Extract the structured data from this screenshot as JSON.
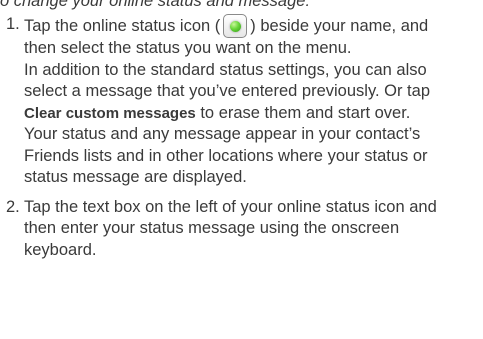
{
  "intro": "o change your online status and message:",
  "steps": [
    {
      "number": "1.",
      "main_before": "Tap the online status icon (",
      "main_after": ") beside your name, and then select the status you want on the menu.",
      "para2_before": "In addition to the standard status settings, you can also select a message that you’ve entered previously. Or tap ",
      "para2_bold": "Clear custom messages",
      "para2_after": " to erase them and start over.",
      "para3": "Your status and any message appear in your contact’s Friends lists and in other locations where your status or status message are displayed."
    },
    {
      "number": "2.",
      "main": "Tap the text box on the left of your online status icon and then enter your status message using the onscreen keyboard."
    }
  ],
  "icons": {
    "status_icon": "online-status-green-dot-icon"
  },
  "colors": {
    "text": "#3a3a3a",
    "status_green": "#6ad63b"
  }
}
